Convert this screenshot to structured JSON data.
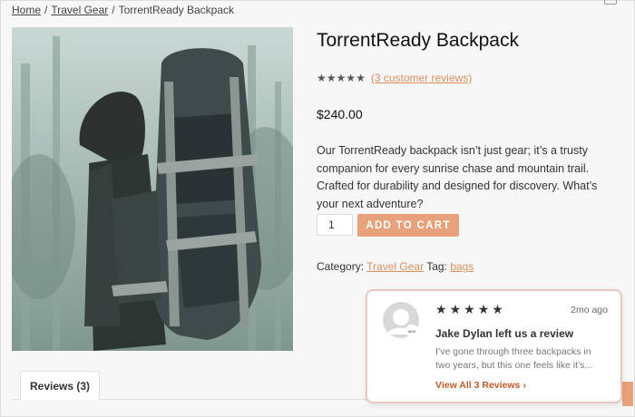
{
  "breadcrumb": {
    "home": "Home",
    "category": "Travel Gear",
    "current": "TorrentReady Backpack",
    "separator": "/"
  },
  "product": {
    "title": "TorrentReady Backpack",
    "rating": 5,
    "reviews_link": "(3 customer reviews)",
    "price": "$240.00",
    "description": "Our TorrentReady backpack isn’t just gear; it’s a trusty companion for every sunrise chase and mountain trail. Crafted for durability and designed for discovery. What’s your next adventure?",
    "quantity": "1",
    "add_to_cart": "ADD TO CART",
    "category_label": "Category:",
    "category_value": "Travel Gear",
    "tag_label": "Tag:",
    "tag_value": "bags"
  },
  "tabs": {
    "reviews": "Reviews (3)"
  },
  "review_popup": {
    "stars": 5,
    "time": "2mo ago",
    "title": "Jake Dylan left us a review",
    "text": "I’ve gone through three backpacks in two years, but this one feels like it’s...",
    "link": "View All 3 Reviews",
    "link_icon": "chevron-right-icon"
  },
  "colors": {
    "accent": "#e7a27b",
    "link": "#d98e5c",
    "card_link": "#c0592a",
    "card_border": "#e8c8bd"
  }
}
